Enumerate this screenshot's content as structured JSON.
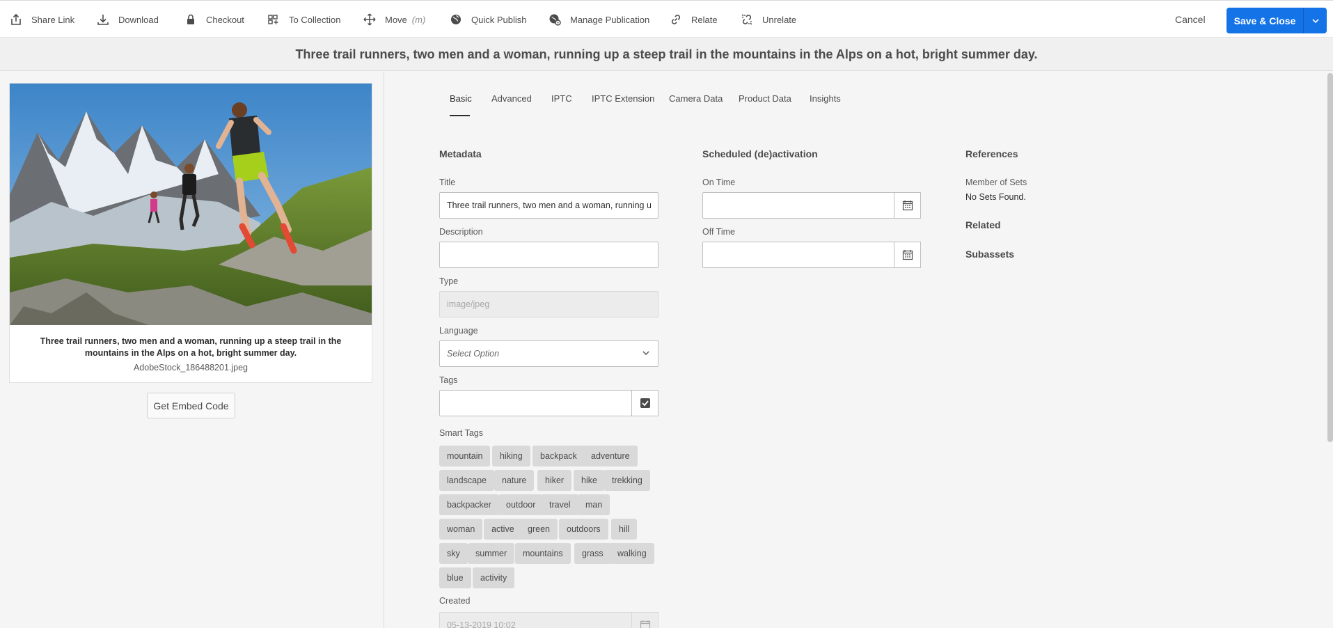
{
  "toolbar": {
    "items": [
      {
        "label": "Share Link",
        "icon": "share-icon"
      },
      {
        "label": "Download",
        "icon": "download-icon"
      },
      {
        "label": "Checkout",
        "icon": "lock-icon"
      },
      {
        "label": "To Collection",
        "icon": "collection-icon"
      },
      {
        "label": "Move",
        "icon": "move-icon",
        "shortcut": "(m)"
      },
      {
        "label": "Quick Publish",
        "icon": "globe-icon"
      },
      {
        "label": "Manage Publication",
        "icon": "globe-gear-icon"
      },
      {
        "label": "Relate",
        "icon": "link-icon"
      },
      {
        "label": "Unrelate",
        "icon": "unlink-icon"
      }
    ],
    "cancel_label": "Cancel",
    "save_label": "Save & Close"
  },
  "title_bar": "Three trail runners, two men and a woman, running up a steep trail in the mountains in the Alps on a hot, bright summer day.",
  "asset_card": {
    "caption": "Three trail runners, two men and a woman, running up a steep trail in the mountains in the Alps on a hot, bright summer day.",
    "filename": "AdobeStock_186488201.jpeg",
    "embed_label": "Get Embed Code"
  },
  "tabs": [
    "Basic",
    "Advanced",
    "IPTC",
    "IPTC Extension",
    "Camera Data",
    "Product Data",
    "Insights"
  ],
  "metadata": {
    "heading": "Metadata",
    "title_label": "Title",
    "title_value": "Three trail runners, two men and a woman, running up a steep trail in the mountains in the Alps on a hot, bright summer day.",
    "description_label": "Description",
    "description_value": "",
    "type_label": "Type",
    "type_value": "image/jpeg",
    "language_label": "Language",
    "language_placeholder": "Select Option",
    "tags_label": "Tags",
    "smart_tags_label": "Smart Tags",
    "smart_tags": [
      "mountain",
      "hiking",
      "backpack",
      "adventure",
      "landscape",
      "nature",
      "hiker",
      "hike",
      "trekking",
      "backpacker",
      "outdoor",
      "travel",
      "man",
      "woman",
      "active",
      "green",
      "outdoors",
      "hill",
      "sky",
      "summer",
      "mountains",
      "grass",
      "walking",
      "blue",
      "activity"
    ],
    "created_label": "Created",
    "created_value": "05-13-2019 10:02"
  },
  "scheduled": {
    "heading": "Scheduled (de)activation",
    "on_time_label": "On Time",
    "off_time_label": "Off Time"
  },
  "references": {
    "heading": "References",
    "member_of_sets_label": "Member of Sets",
    "member_of_sets_value": "No Sets Found.",
    "related_label": "Related",
    "subassets_label": "Subassets"
  },
  "colors": {
    "accent": "#1473e6",
    "tag_bg": "#d9d9d9"
  }
}
